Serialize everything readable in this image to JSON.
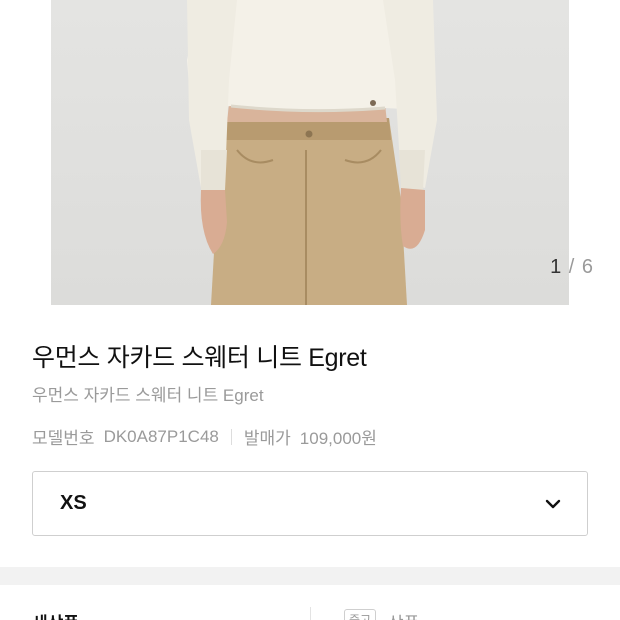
{
  "gallery": {
    "current": "1",
    "separator": "/",
    "total": "6"
  },
  "product": {
    "title": "우먼스 자카드 스웨터 니트 Egret",
    "subtitle": "우먼스 자카드 스웨터 니트 Egret",
    "model_label": "모델번호",
    "model_number": "DK0A87P1C48",
    "release_price_label": "발매가",
    "release_price": "109,000원"
  },
  "size_select": {
    "value": "XS",
    "icon": "chevron-down-icon"
  },
  "bottom_tabs": {
    "new_label": "새상품",
    "used_badge": "중고",
    "used_label": "상품"
  }
}
